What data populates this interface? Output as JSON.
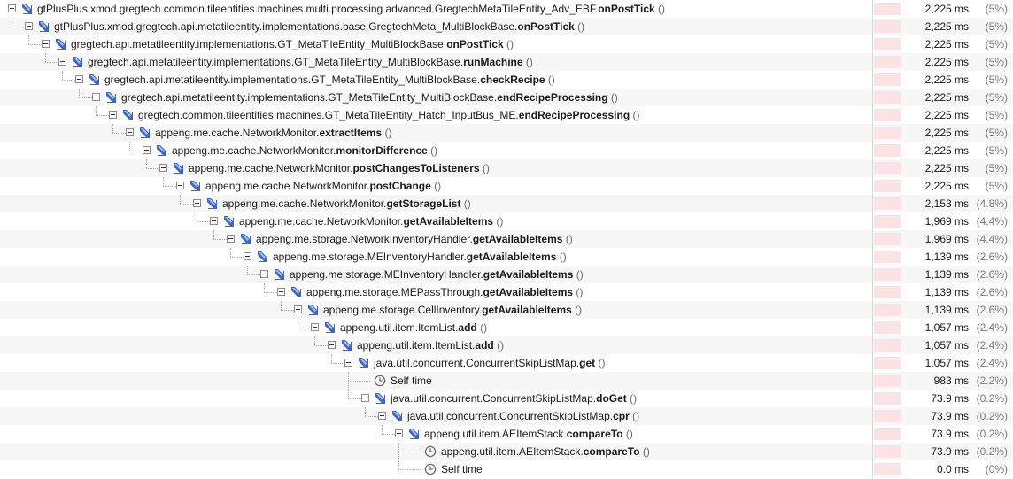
{
  "colors": {
    "bar_fill": "#fbe3e3",
    "call_icon": "#3b66c4",
    "self_icon": "#6b6b6b"
  },
  "rows": [
    {
      "depth": 0,
      "kind": "call",
      "pkg": "gtPlusPlus.xmod.gregtech.common.tileentities.machines.multi.processing.advanced.GregtechMetaTileEntity_Adv_EBF.",
      "method": "onPostTick",
      "parens": " ()",
      "time": "2,225 ms",
      "pct": "(5%)",
      "share": 0.05
    },
    {
      "depth": 1,
      "kind": "call",
      "pkg": "gtPlusPlus.xmod.gregtech.api.metatileentity.implementations.base.GregtechMeta_MultiBlockBase.",
      "method": "onPostTick",
      "parens": " ()",
      "time": "2,225 ms",
      "pct": "(5%)",
      "share": 0.05
    },
    {
      "depth": 2,
      "kind": "call",
      "pkg": "gregtech.api.metatileentity.implementations.GT_MetaTileEntity_MultiBlockBase.",
      "method": "onPostTick",
      "parens": " ()",
      "time": "2,225 ms",
      "pct": "(5%)",
      "share": 0.05
    },
    {
      "depth": 3,
      "kind": "call",
      "pkg": "gregtech.api.metatileentity.implementations.GT_MetaTileEntity_MultiBlockBase.",
      "method": "runMachine",
      "parens": " ()",
      "time": "2,225 ms",
      "pct": "(5%)",
      "share": 0.05
    },
    {
      "depth": 4,
      "kind": "call",
      "pkg": "gregtech.api.metatileentity.implementations.GT_MetaTileEntity_MultiBlockBase.",
      "method": "checkRecipe",
      "parens": " ()",
      "time": "2,225 ms",
      "pct": "(5%)",
      "share": 0.05
    },
    {
      "depth": 5,
      "kind": "call",
      "pkg": "gregtech.api.metatileentity.implementations.GT_MetaTileEntity_MultiBlockBase.",
      "method": "endRecipeProcessing",
      "parens": " ()",
      "time": "2,225 ms",
      "pct": "(5%)",
      "share": 0.05
    },
    {
      "depth": 6,
      "kind": "call",
      "pkg": "gregtech.common.tileentities.machines.GT_MetaTileEntity_Hatch_InputBus_ME.",
      "method": "endRecipeProcessing",
      "parens": " ()",
      "time": "2,225 ms",
      "pct": "(5%)",
      "share": 0.05
    },
    {
      "depth": 7,
      "kind": "call",
      "pkg": "appeng.me.cache.NetworkMonitor.",
      "method": "extractItems",
      "parens": " ()",
      "time": "2,225 ms",
      "pct": "(5%)",
      "share": 0.05
    },
    {
      "depth": 8,
      "kind": "call",
      "pkg": "appeng.me.cache.NetworkMonitor.",
      "method": "monitorDifference",
      "parens": " ()",
      "time": "2,225 ms",
      "pct": "(5%)",
      "share": 0.05
    },
    {
      "depth": 9,
      "kind": "call",
      "pkg": "appeng.me.cache.NetworkMonitor.",
      "method": "postChangesToListeners",
      "parens": " ()",
      "time": "2,225 ms",
      "pct": "(5%)",
      "share": 0.05
    },
    {
      "depth": 10,
      "kind": "call",
      "pkg": "appeng.me.cache.NetworkMonitor.",
      "method": "postChange",
      "parens": " ()",
      "time": "2,225 ms",
      "pct": "(5%)",
      "share": 0.05
    },
    {
      "depth": 11,
      "kind": "call",
      "pkg": "appeng.me.cache.NetworkMonitor.",
      "method": "getStorageList",
      "parens": " ()",
      "time": "2,153 ms",
      "pct": "(4.8%)",
      "share": 0.048
    },
    {
      "depth": 12,
      "kind": "call",
      "pkg": "appeng.me.cache.NetworkMonitor.",
      "method": "getAvailableItems",
      "parens": " ()",
      "time": "1,969 ms",
      "pct": "(4.4%)",
      "share": 0.044
    },
    {
      "depth": 13,
      "kind": "call",
      "pkg": "appeng.me.storage.NetworkInventoryHandler.",
      "method": "getAvailableItems",
      "parens": " ()",
      "time": "1,969 ms",
      "pct": "(4.4%)",
      "share": 0.044
    },
    {
      "depth": 14,
      "kind": "call",
      "pkg": "appeng.me.storage.MEInventoryHandler.",
      "method": "getAvailableItems",
      "parens": " ()",
      "time": "1,139 ms",
      "pct": "(2.6%)",
      "share": 0.026
    },
    {
      "depth": 15,
      "kind": "call",
      "pkg": "appeng.me.storage.MEInventoryHandler.",
      "method": "getAvailableItems",
      "parens": " ()",
      "time": "1,139 ms",
      "pct": "(2.6%)",
      "share": 0.026
    },
    {
      "depth": 16,
      "kind": "call",
      "pkg": "appeng.me.storage.MEPassThrough.",
      "method": "getAvailableItems",
      "parens": " ()",
      "time": "1,139 ms",
      "pct": "(2.6%)",
      "share": 0.026
    },
    {
      "depth": 17,
      "kind": "call",
      "pkg": "appeng.me.storage.CellInventory.",
      "method": "getAvailableItems",
      "parens": " ()",
      "time": "1,139 ms",
      "pct": "(2.6%)",
      "share": 0.026
    },
    {
      "depth": 18,
      "kind": "call",
      "pkg": "appeng.util.item.ItemList.",
      "method": "add",
      "parens": " ()",
      "time": "1,057 ms",
      "pct": "(2.4%)",
      "share": 0.024
    },
    {
      "depth": 19,
      "kind": "call",
      "pkg": "appeng.util.item.ItemList.",
      "method": "add",
      "parens": " ()",
      "time": "1,057 ms",
      "pct": "(2.4%)",
      "share": 0.024
    },
    {
      "depth": 20,
      "kind": "call",
      "pkg": "java.util.concurrent.ConcurrentSkipListMap.",
      "method": "get",
      "parens": " ()",
      "time": "1,057 ms",
      "pct": "(2.4%)",
      "share": 0.024
    },
    {
      "depth": 21,
      "kind": "self",
      "pkg": "Self time",
      "method": "",
      "parens": "",
      "time": "983 ms",
      "pct": "(2.2%)",
      "share": 0.022
    },
    {
      "depth": 21,
      "kind": "call",
      "pkg": "java.util.concurrent.ConcurrentSkipListMap.",
      "method": "doGet",
      "parens": " ()",
      "time": "73.9 ms",
      "pct": "(0.2%)",
      "share": 0.002
    },
    {
      "depth": 22,
      "kind": "call",
      "pkg": "java.util.concurrent.ConcurrentSkipListMap.",
      "method": "cpr",
      "parens": " ()",
      "time": "73.9 ms",
      "pct": "(0.2%)",
      "share": 0.002
    },
    {
      "depth": 23,
      "kind": "call",
      "pkg": "appeng.util.item.AEItemStack.",
      "method": "compareTo",
      "parens": " ()",
      "time": "73.9 ms",
      "pct": "(0.2%)",
      "share": 0.002
    },
    {
      "depth": 24,
      "kind": "self",
      "pkg": "appeng.util.item.AEItemStack.",
      "method": "compareTo",
      "parens": " ()",
      "time": "73.9 ms",
      "pct": "(0.2%)",
      "share": 0.002
    },
    {
      "depth": 24,
      "kind": "self",
      "pkg": "Self time",
      "method": "",
      "parens": "",
      "time": "0.0 ms",
      "pct": "(0%)",
      "share": 0.0
    }
  ]
}
